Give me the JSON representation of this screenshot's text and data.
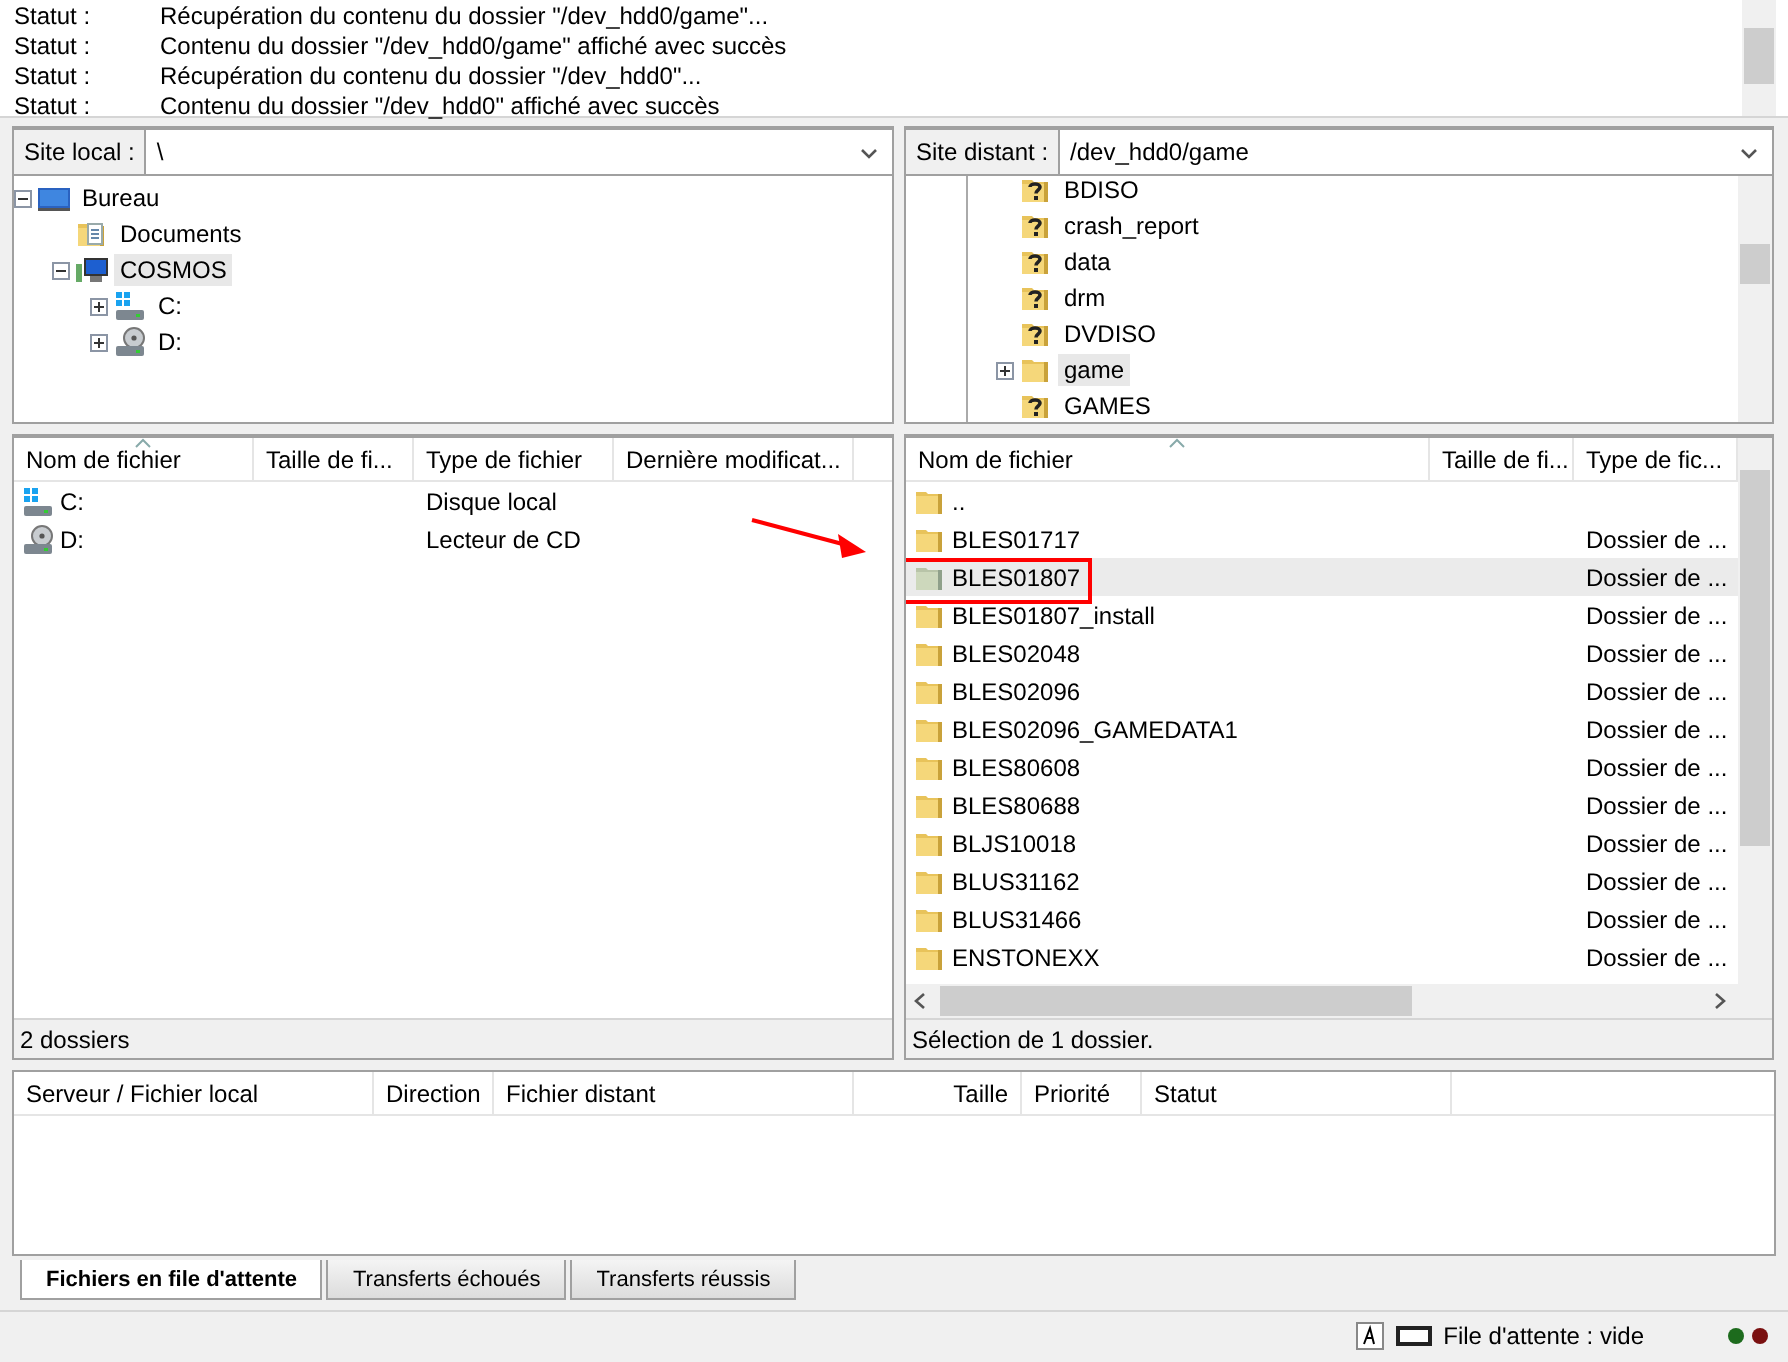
{
  "log": [
    {
      "label": "Statut :",
      "message": "Récupération du contenu du dossier \"/dev_hdd0/game\"..."
    },
    {
      "label": "Statut :",
      "message": "Contenu du dossier \"/dev_hdd0/game\" affiché avec succès"
    },
    {
      "label": "Statut :",
      "message": "Récupération du contenu du dossier \"/dev_hdd0\"..."
    },
    {
      "label": "Statut :",
      "message": "Contenu du dossier \"/dev_hdd0\" affiché avec succès"
    }
  ],
  "local": {
    "label": "Site local :",
    "path": "\\",
    "tree": [
      {
        "label": "Bureau",
        "kind": "desktop",
        "has_children": true,
        "expanded": true,
        "selected": false,
        "children": [
          {
            "label": "Documents",
            "kind": "documents",
            "has_children": false,
            "selected": false
          },
          {
            "label": "COSMOS",
            "kind": "computer",
            "has_children": true,
            "expanded": true,
            "selected": true,
            "children": [
              {
                "label": "C:",
                "kind": "drive",
                "has_children": true,
                "expanded": false,
                "selected": false
              },
              {
                "label": "D:",
                "kind": "cd",
                "has_children": true,
                "expanded": false,
                "selected": false
              }
            ]
          }
        ]
      }
    ],
    "columns": [
      {
        "label": "Nom de fichier",
        "sorted": true
      },
      {
        "label": "Taille de fi...",
        "sorted": false
      },
      {
        "label": "Type de fichier",
        "sorted": false
      },
      {
        "label": "Dernière modificat...",
        "sorted": false
      }
    ],
    "rows": [
      {
        "name": "C:",
        "kind": "drive",
        "type": "Disque local",
        "selected": false,
        "marked": false
      },
      {
        "name": "D:",
        "kind": "cd",
        "type": "Lecteur de CD",
        "selected": false,
        "marked": false
      }
    ],
    "status": "2 dossiers"
  },
  "remote": {
    "label": "Site distant :",
    "path": "/dev_hdd0/game",
    "tree": [
      {
        "label": "BDISO",
        "kind": "unknown",
        "has_children": false,
        "selected": false
      },
      {
        "label": "crash_report",
        "kind": "unknown",
        "has_children": false,
        "selected": false
      },
      {
        "label": "data",
        "kind": "unknown",
        "has_children": false,
        "selected": false
      },
      {
        "label": "drm",
        "kind": "unknown",
        "has_children": false,
        "selected": false
      },
      {
        "label": "DVDISO",
        "kind": "unknown",
        "has_children": false,
        "selected": false
      },
      {
        "label": "game",
        "kind": "folder",
        "has_children": true,
        "expanded": false,
        "selected": true
      },
      {
        "label": "GAMES",
        "kind": "unknown",
        "has_children": false,
        "selected": false
      }
    ],
    "columns": [
      {
        "label": "Nom de fichier",
        "sorted": true
      },
      {
        "label": "Taille de fi...",
        "sorted": false
      },
      {
        "label": "Type de fic...",
        "sorted": false
      }
    ],
    "rows": [
      {
        "name": "..",
        "kind": "folder",
        "selected": false,
        "marked": false
      },
      {
        "name": "BLES01717",
        "kind": "folder",
        "type": "Dossier de ...",
        "selected": false,
        "marked": false
      },
      {
        "name": "BLES01807",
        "kind": "folder",
        "type": "Dossier de ...",
        "selected": true,
        "marked": true
      },
      {
        "name": "BLES01807_install",
        "kind": "folder",
        "type": "Dossier de ...",
        "selected": false,
        "marked": false
      },
      {
        "name": "BLES02048",
        "kind": "folder",
        "type": "Dossier de ...",
        "selected": false,
        "marked": false
      },
      {
        "name": "BLES02096",
        "kind": "folder",
        "type": "Dossier de ...",
        "selected": false,
        "marked": false
      },
      {
        "name": "BLES02096_GAMEDATA1",
        "kind": "folder",
        "type": "Dossier de ...",
        "selected": false,
        "marked": false
      },
      {
        "name": "BLES80608",
        "kind": "folder",
        "type": "Dossier de ...",
        "selected": false,
        "marked": false
      },
      {
        "name": "BLES80688",
        "kind": "folder",
        "type": "Dossier de ...",
        "selected": false,
        "marked": false
      },
      {
        "name": "BLJS10018",
        "kind": "folder",
        "type": "Dossier de ...",
        "selected": false,
        "marked": false
      },
      {
        "name": "BLUS31162",
        "kind": "folder",
        "type": "Dossier de ...",
        "selected": false,
        "marked": false
      },
      {
        "name": "BLUS31466",
        "kind": "folder",
        "type": "Dossier de ...",
        "selected": false,
        "marked": false
      },
      {
        "name": "ENSTONEXX",
        "kind": "folder",
        "type": "Dossier de ...",
        "selected": false,
        "marked": false
      }
    ],
    "status": "Sélection de 1 dossier."
  },
  "queue": {
    "columns": [
      {
        "label": "Serveur / Fichier local"
      },
      {
        "label": "Direction"
      },
      {
        "label": "Fichier distant"
      },
      {
        "label": "Taille"
      },
      {
        "label": "Priorité"
      },
      {
        "label": "Statut"
      }
    ],
    "tabs": [
      {
        "label": "Fichiers en file d'attente",
        "selected": true
      },
      {
        "label": "Transferts échoués",
        "selected": false
      },
      {
        "label": "Transferts réussis",
        "selected": false
      }
    ]
  },
  "status_bar": {
    "queue": "File d'attente : vide"
  }
}
